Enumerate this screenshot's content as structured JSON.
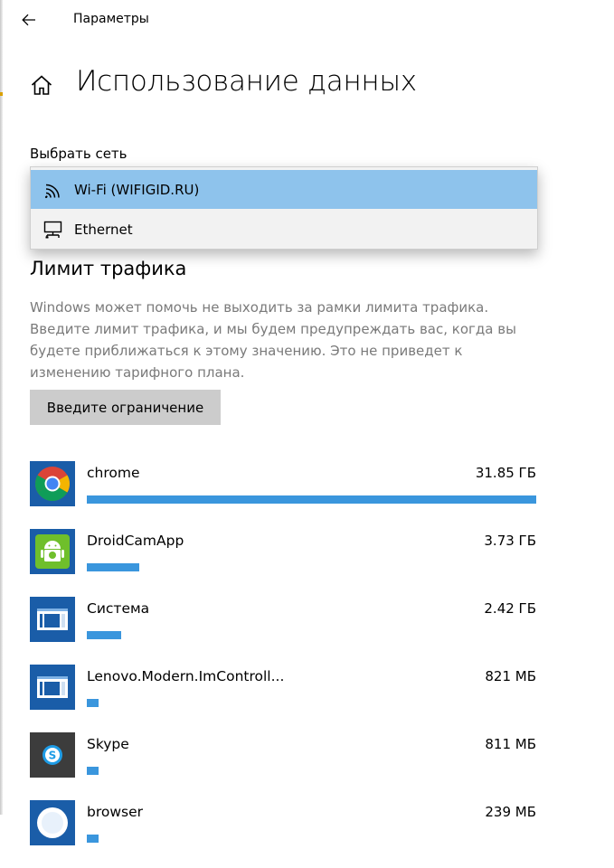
{
  "window": {
    "app_title": "Параметры",
    "back_icon": "arrow-left-icon"
  },
  "header": {
    "home_icon": "home-icon",
    "title": "Использование данных"
  },
  "network_select": {
    "label": "Выбрать сеть",
    "options": [
      {
        "label": "Wi-Fi (WIFIGID.RU)",
        "icon": "wifi-icon",
        "selected": true
      },
      {
        "label": "Ethernet",
        "icon": "ethernet-icon",
        "selected": false
      }
    ],
    "highlight_color": "#8ec3ec"
  },
  "traffic_limit": {
    "title": "Лимит трафика",
    "description": "Windows может помочь не выходить за рамки лимита трафика. Введите лимит трафика, и мы будем предупреждать вас, когда вы будете приближаться к этому значению. Это не приведет к изменению тарифного плана.",
    "button_label": "Введите ограничение"
  },
  "accent_color": "#3a96dd",
  "apps": [
    {
      "name": "chrome",
      "usage": "31.85 ГБ",
      "fraction": 1.0,
      "icon": "chrome-icon"
    },
    {
      "name": "DroidCamApp",
      "usage": "3.73 ГБ",
      "fraction": 0.117,
      "icon": "android-icon"
    },
    {
      "name": "Система",
      "usage": "2.42 ГБ",
      "fraction": 0.076,
      "icon": "system-window-icon"
    },
    {
      "name": "Lenovo.Modern.ImControll...",
      "usage": "821 МБ",
      "fraction": 0.025,
      "icon": "system-window-icon"
    },
    {
      "name": "Skype",
      "usage": "811 МБ",
      "fraction": 0.025,
      "icon": "skype-icon"
    },
    {
      "name": "browser",
      "usage": "239 МБ",
      "fraction": 0.007,
      "icon": "browser-icon"
    }
  ]
}
